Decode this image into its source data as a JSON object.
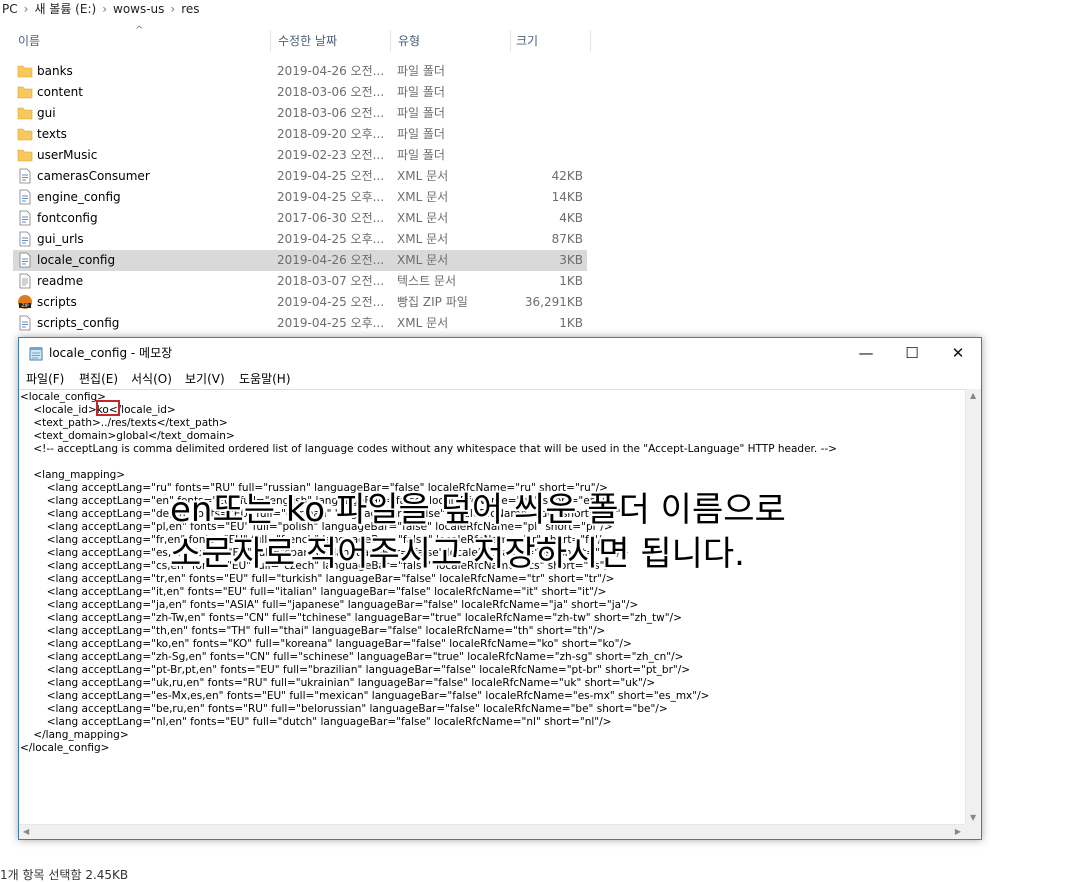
{
  "breadcrumb": [
    "PC",
    "새 볼륨 (E:)",
    "wows-us",
    "res"
  ],
  "columns": {
    "name": "이름",
    "date": "수정한 날짜",
    "type": "유형",
    "size": "크기"
  },
  "files": [
    {
      "name": "banks",
      "date": "2019-04-26 오전...",
      "type": "파일 폴더",
      "size": "",
      "icon": "folder-icon"
    },
    {
      "name": "content",
      "date": "2018-03-06 오전...",
      "type": "파일 폴더",
      "size": "",
      "icon": "folder-icon"
    },
    {
      "name": "gui",
      "date": "2018-03-06 오전...",
      "type": "파일 폴더",
      "size": "",
      "icon": "folder-icon"
    },
    {
      "name": "texts",
      "date": "2018-09-20 오후...",
      "type": "파일 폴더",
      "size": "",
      "icon": "folder-icon"
    },
    {
      "name": "userMusic",
      "date": "2019-02-23 오전...",
      "type": "파일 폴더",
      "size": "",
      "icon": "folder-icon"
    },
    {
      "name": "camerasConsumer",
      "date": "2019-04-25 오전...",
      "type": "XML 문서",
      "size": "42KB",
      "icon": "xml-file-icon"
    },
    {
      "name": "engine_config",
      "date": "2019-04-25 오후...",
      "type": "XML 문서",
      "size": "14KB",
      "icon": "xml-file-icon"
    },
    {
      "name": "fontconfig",
      "date": "2017-06-30 오전...",
      "type": "XML 문서",
      "size": "4KB",
      "icon": "xml-file-icon"
    },
    {
      "name": "gui_urls",
      "date": "2019-04-25 오후...",
      "type": "XML 문서",
      "size": "87KB",
      "icon": "xml-file-icon"
    },
    {
      "name": "locale_config",
      "date": "2019-04-26 오전...",
      "type": "XML 문서",
      "size": "3KB",
      "icon": "xml-file-icon",
      "selected": true
    },
    {
      "name": "readme",
      "date": "2018-03-07 오전...",
      "type": "텍스트 문서",
      "size": "1KB",
      "icon": "text-file-icon"
    },
    {
      "name": "scripts",
      "date": "2019-04-25 오전...",
      "type": "빵집 ZIP 파일",
      "size": "36,291KB",
      "icon": "zip-file-icon"
    },
    {
      "name": "scripts_config",
      "date": "2019-04-25 오후...",
      "type": "XML 문서",
      "size": "1KB",
      "icon": "xml-file-icon"
    }
  ],
  "status_bar": "1개 항목 선택함 2.45KB",
  "notepad": {
    "title": "locale_config - 메모장",
    "controls": {
      "minimize": "—",
      "maximize": "☐",
      "close": "✕"
    },
    "menu": [
      "파일(F)",
      "편집(E)",
      "서식(O)",
      "보기(V)",
      "도움말(H)"
    ],
    "lines": [
      "<locale_config>",
      "    <locale_id>ko</locale_id>",
      "    <text_path>../res/texts</text_path>",
      "    <text_domain>global</text_domain>",
      "    <!-- acceptLang is comma delimited ordered list of language codes without any whitespace that will be used in the \"Accept-Language\" HTTP header. -->",
      "",
      "    <lang_mapping>",
      "        <lang acceptLang=\"ru\" fonts=\"RU\" full=\"russian\" languageBar=\"false\" localeRfcName=\"ru\" short=\"ru\"/>",
      "        <lang acceptLang=\"en\" fonts=\"EU\" full=\"english\" languageBar=\"false\" localeRfcName=\"en\" short=\"en\"/>",
      "        <lang acceptLang=\"de,en\" fonts=\"EU\" full=\"german\" languageBar=\"false\" localeRfcName=\"de\" short=\"de\"/>",
      "        <lang acceptLang=\"pl,en\" fonts=\"EU\" full=\"polish\" languageBar=\"false\" localeRfcName=\"pl\" short=\"pl\"/>",
      "        <lang acceptLang=\"fr,en\" fonts=\"EU\" full=\"french\" languageBar=\"false\" localeRfcName=\"fr\" short=\"fr\"/>",
      "        <lang acceptLang=\"es,en\" fonts=\"EU\" full=\"spanish\" languageBar=\"false\" localeRfcName=\"es\" short=\"es\"/>",
      "        <lang acceptLang=\"cs,en\" fonts=\"EU\" full=\"czech\" languageBar=\"false\" localeRfcName=\"cs\" short=\"cs\"/>",
      "        <lang acceptLang=\"tr,en\" fonts=\"EU\" full=\"turkish\" languageBar=\"false\" localeRfcName=\"tr\" short=\"tr\"/>",
      "        <lang acceptLang=\"it,en\" fonts=\"EU\" full=\"italian\" languageBar=\"false\" localeRfcName=\"it\" short=\"it\"/>",
      "        <lang acceptLang=\"ja,en\" fonts=\"ASIA\" full=\"japanese\" languageBar=\"false\" localeRfcName=\"ja\" short=\"ja\"/>",
      "        <lang acceptLang=\"zh-Tw,en\" fonts=\"CN\" full=\"tchinese\" languageBar=\"true\" localeRfcName=\"zh-tw\" short=\"zh_tw\"/>",
      "        <lang acceptLang=\"th,en\" fonts=\"TH\" full=\"thai\" languageBar=\"false\" localeRfcName=\"th\" short=\"th\"/>",
      "        <lang acceptLang=\"ko,en\" fonts=\"KO\" full=\"koreana\" languageBar=\"false\" localeRfcName=\"ko\" short=\"ko\"/>",
      "        <lang acceptLang=\"zh-Sg,en\" fonts=\"CN\" full=\"schinese\" languageBar=\"true\" localeRfcName=\"zh-sg\" short=\"zh_cn\"/>",
      "        <lang acceptLang=\"pt-Br,pt,en\" fonts=\"EU\" full=\"brazilian\" languageBar=\"false\" localeRfcName=\"pt-br\" short=\"pt_br\"/>",
      "        <lang acceptLang=\"uk,ru,en\" fonts=\"RU\" full=\"ukrainian\" languageBar=\"false\" localeRfcName=\"uk\" short=\"uk\"/>",
      "        <lang acceptLang=\"es-Mx,es,en\" fonts=\"EU\" full=\"mexican\" languageBar=\"false\" localeRfcName=\"es-mx\" short=\"es_mx\"/>",
      "        <lang acceptLang=\"be,ru,en\" fonts=\"RU\" full=\"belorussian\" languageBar=\"false\" localeRfcName=\"be\" short=\"be\"/>",
      "        <lang acceptLang=\"nl,en\" fonts=\"EU\" full=\"dutch\" languageBar=\"false\" localeRfcName=\"nl\" short=\"nl\"/>",
      "    </lang_mapping>",
      "</locale_config>"
    ]
  },
  "overlay_text": {
    "line1": "en또는 ko 파일을 덮어 씌운 폴더 이름으로",
    "line2": "소문자로 적어주시고 저장하시면 됩니다."
  },
  "colors": {
    "selected_row": "#d9d9d9",
    "window_border": "#3c7fb1",
    "highlight_box": "#c1272d",
    "folder": "#f8c85c"
  }
}
